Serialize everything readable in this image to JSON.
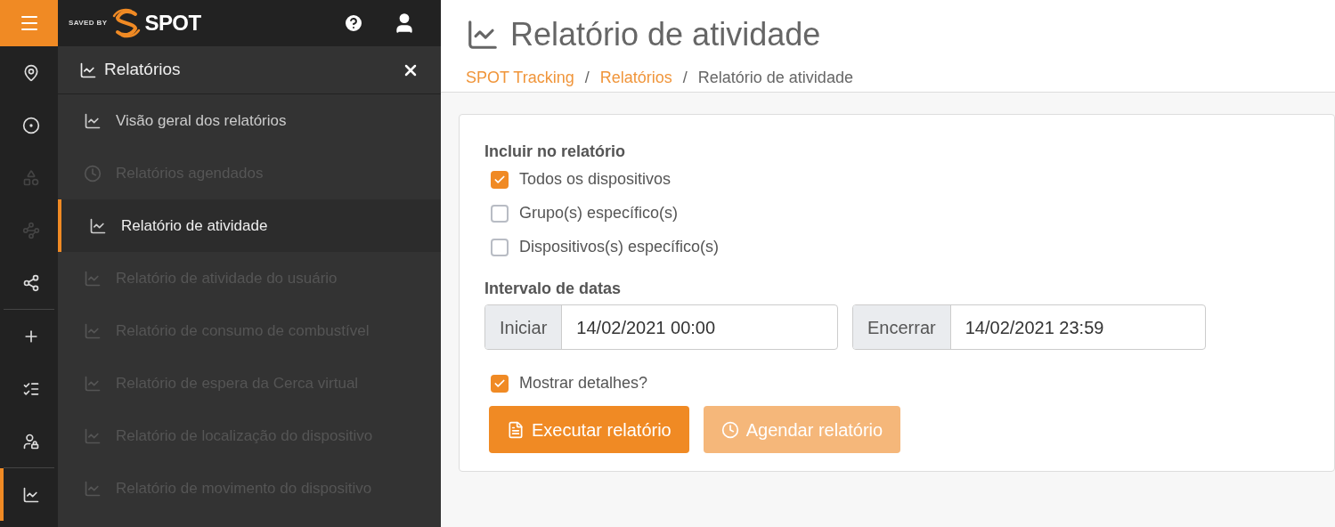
{
  "rail": [
    {
      "kind": "pin",
      "disabled": false,
      "selected": false
    },
    {
      "kind": "target",
      "disabled": false,
      "selected": false
    },
    {
      "kind": "shapes",
      "disabled": true,
      "selected": false
    },
    {
      "kind": "route",
      "disabled": true,
      "selected": false
    },
    {
      "kind": "share",
      "disabled": false,
      "selected": false
    },
    {
      "kind": "plus",
      "disabled": false,
      "selected": false
    },
    {
      "kind": "checklist",
      "disabled": false,
      "selected": false
    },
    {
      "kind": "user-lock",
      "disabled": false,
      "selected": false
    },
    {
      "kind": "chart",
      "disabled": false,
      "selected": true
    }
  ],
  "brand": {
    "tagline": "SAVED BY",
    "name": "SPOT"
  },
  "sidebar": {
    "title": "Relatórios",
    "items": [
      {
        "label": "Visão geral dos relatórios",
        "kind": "chart",
        "disabled": false,
        "selected": false
      },
      {
        "label": "Relatórios agendados",
        "kind": "clock",
        "disabled": true,
        "selected": false
      },
      {
        "label": "Relatório de atividade",
        "kind": "chart",
        "disabled": false,
        "selected": true
      },
      {
        "label": "Relatório de atividade do usuário",
        "kind": "chart",
        "disabled": true,
        "selected": false
      },
      {
        "label": "Relatório de consumo de combustível",
        "kind": "chart",
        "disabled": true,
        "selected": false
      },
      {
        "label": "Relatório de espera da Cerca virtual",
        "kind": "chart",
        "disabled": true,
        "selected": false
      },
      {
        "label": "Relatório de localização do dispositivo",
        "kind": "chart",
        "disabled": true,
        "selected": false
      },
      {
        "label": "Relatório de movimento do dispositivo",
        "kind": "chart",
        "disabled": true,
        "selected": false
      }
    ]
  },
  "page": {
    "title": "Relatório de atividade",
    "separators": [
      "/",
      "/"
    ],
    "breadcrumb": [
      {
        "label": "SPOT Tracking",
        "link": true
      },
      {
        "label": "Relatórios",
        "link": true
      },
      {
        "label": "Relatório de atividade",
        "link": false
      }
    ]
  },
  "form": {
    "include_label": "Incluir no relatório",
    "options": [
      {
        "label": "Todos os dispositivos",
        "checked": true
      },
      {
        "label": "Grupo(s) específico(s)",
        "checked": false
      },
      {
        "label": "Dispositivos(s) específico(s)",
        "checked": false
      }
    ],
    "date_label": "Intervalo de datas",
    "dates": [
      {
        "addon": "Iniciar",
        "value": "14/02/2021 00:00"
      },
      {
        "addon": "Encerrar",
        "value": "14/02/2021 23:59"
      }
    ],
    "details": {
      "label": "Mostrar detalhes?",
      "checked": true
    },
    "buttons": [
      {
        "label": "Executar relatório",
        "kind": "file",
        "disabled": false
      },
      {
        "label": "Agendar relatório",
        "kind": "clock",
        "disabled": true
      }
    ]
  }
}
